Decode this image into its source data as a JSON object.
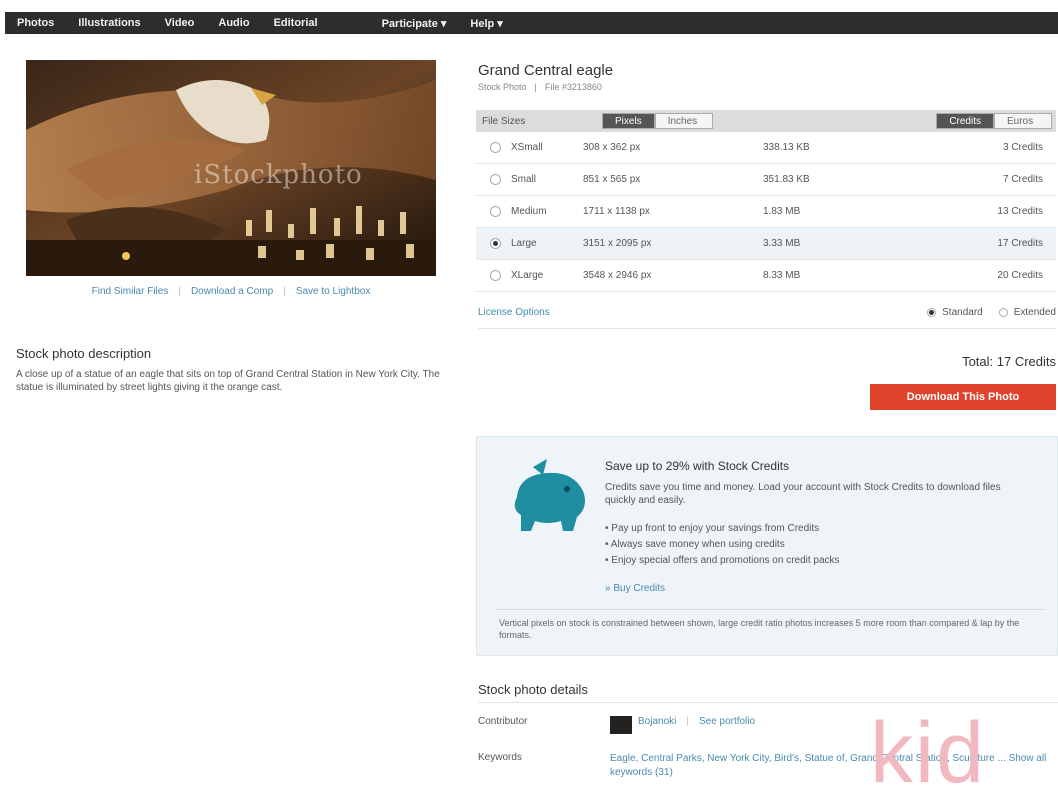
{
  "nav": {
    "items": [
      "Photos",
      "Illustrations",
      "Video",
      "Audio",
      "Editorial"
    ],
    "right_items": [
      "Participate ▾",
      "Help ▾"
    ]
  },
  "photo": {
    "watermark": "iStockphoto",
    "links": [
      "Find Similar Files",
      "Download a Comp",
      "Save to Lightbox"
    ]
  },
  "description": {
    "title": "Stock photo description",
    "text": "A close up of a statue of an eagle that sits on top of Grand Central Station in New York City. The statue is illuminated by street lights giving it the orange cast."
  },
  "asset": {
    "title": "Grand Central eagle",
    "type": "Stock Photo",
    "file_no": "File #3213860"
  },
  "sizes": {
    "header_label": "File Sizes",
    "toggle_a": "Pixels",
    "toggle_b": "Inches",
    "toggle_c": "Credits",
    "toggle_d": "Euros",
    "rows": [
      {
        "name": "XSmall",
        "dims": "308 x 362 px",
        "file": "338.13 KB",
        "credits": "3 Credits",
        "selected": false
      },
      {
        "name": "Small",
        "dims": "851 x 565 px",
        "file": "351.83 KB",
        "credits": "7 Credits",
        "selected": false
      },
      {
        "name": "Medium",
        "dims": "1711 x 1138 px",
        "file": "1.83 MB",
        "credits": "13 Credits",
        "selected": false
      },
      {
        "name": "Large",
        "dims": "3151 x 2095 px",
        "file": "3.33 MB",
        "credits": "17 Credits",
        "selected": true
      },
      {
        "name": "XLarge",
        "dims": "3548 x 2946 px",
        "file": "8.33 MB",
        "credits": "20 Credits",
        "selected": false
      }
    ]
  },
  "license": {
    "link": "License Options",
    "opt_a": "Standard",
    "opt_b": "Extended"
  },
  "total": "Total: 17 Credits",
  "download_label": "Download This Photo",
  "promo": {
    "title": "Save up to 29% with Stock Credits",
    "text": "Credits save you time and money. Load your account with Stock Credits to download files quickly and easily.",
    "bullets": [
      "Pay up front to enjoy your savings from Credits",
      "Always save money when using credits",
      "Enjoy special offers and promotions on credit packs"
    ],
    "link": "» Buy Credits",
    "note": "Vertical pixels on stock is constrained between shown, large credit ratio photos increases 5 more room than compared & lap by the formats."
  },
  "details": {
    "title": "Stock photo details",
    "contributor_label": "Contributor",
    "contributor_name": "Bojanoki",
    "contributor_link": "See portfolio",
    "keywords_label": "Keywords",
    "keywords": "Eagle, Central Parks, New York City, Bird's, Statue of, Grand Central Station, Sculpture ... Show all keywords (31)"
  },
  "brand": "kid",
  "colors": {
    "nav_bg": "#2d2d2d",
    "download_btn": "#e0422b",
    "link": "#4a8ab0",
    "promo_bg": "#eef4f7"
  }
}
